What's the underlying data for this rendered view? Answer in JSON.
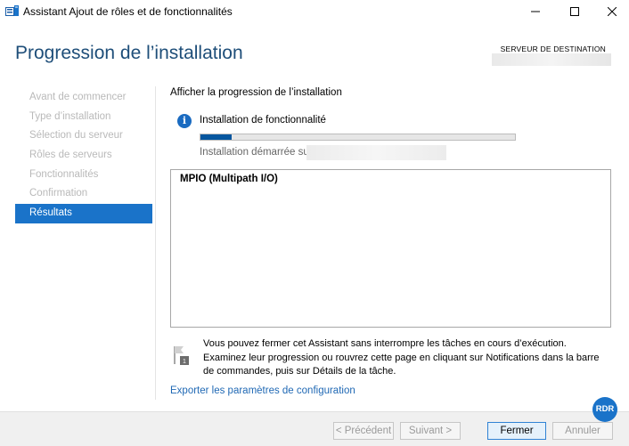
{
  "window": {
    "title": "Assistant Ajout de rôles et de fonctionnalités"
  },
  "header": {
    "page_title": "Progression de l’installation",
    "destination_label": "SERVEUR DE DESTINATION"
  },
  "nav": {
    "items": [
      {
        "label": "Avant de commencer"
      },
      {
        "label": "Type d’installation"
      },
      {
        "label": "Sélection du serveur"
      },
      {
        "label": "Rôles de serveurs"
      },
      {
        "label": "Fonctionnalités"
      },
      {
        "label": "Confirmation"
      },
      {
        "label": "Résultats"
      }
    ],
    "active_index": 6
  },
  "content": {
    "section_title": "Afficher la progression de l’installation",
    "status_label": "Installation de fonctionnalité",
    "progress_percent": 10,
    "started_label": "Installation démarrée sur",
    "results": [
      "MPIO (Multipath I/O)"
    ],
    "notice": "Vous pouvez fermer cet Assistant sans interrompre les tâches en cours d’exécution. Examinez leur progression ou rouvrez cette page en cliquant sur Notifications dans la barre de commandes, puis sur Détails de la tâche.",
    "export_link": "Exporter les paramètres de configuration"
  },
  "footer": {
    "prev_label": "< Précédent",
    "next_label": "Suivant >",
    "close_label": "Fermer",
    "cancel_label": "Annuler"
  },
  "badge": {
    "label": "RDR"
  },
  "colors": {
    "accent": "#1a73c9",
    "title": "#1e4e79",
    "progress": "#06569f",
    "link": "#1f68b4"
  }
}
